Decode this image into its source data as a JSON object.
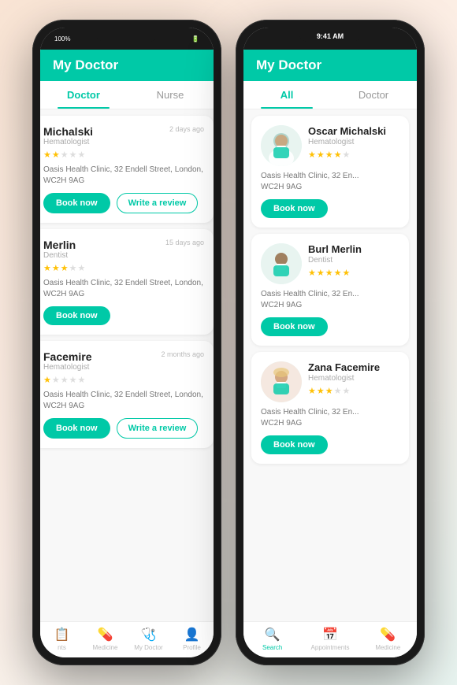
{
  "colors": {
    "primary": "#00C9A7",
    "white": "#ffffff",
    "text_dark": "#222222",
    "text_gray": "#aaaaaa",
    "text_light": "#777777",
    "star_filled": "#FFC107",
    "star_empty": "#dddddd"
  },
  "left_phone": {
    "status_bar": {
      "battery": "100%",
      "time": ""
    },
    "header": {
      "title": "My Doctor"
    },
    "tabs": [
      {
        "label": "Doctor",
        "active": true
      },
      {
        "label": "Nurse",
        "active": false
      }
    ],
    "doctors": [
      {
        "name": "Michalski",
        "full_name": "Oscar Michalski",
        "specialty": "Hematologist",
        "timestamp": "2 days ago",
        "stars": [
          true,
          true,
          false,
          false,
          false
        ],
        "address": "Oasis Health Clinic, 32 Endell Street, London, WC2H 9AG",
        "show_book": true,
        "show_review": true
      },
      {
        "name": "Merlin",
        "full_name": "Burl Merlin",
        "specialty": "Dentist",
        "timestamp": "15 days ago",
        "stars": [
          true,
          true,
          true,
          false,
          false
        ],
        "address": "Oasis Health Clinic, 32 Endell Street, London, WC2H 9AG",
        "show_book": true,
        "show_review": false
      },
      {
        "name": "Facemire",
        "full_name": "Zana Facemire",
        "specialty": "Hematologist",
        "timestamp": "2 months ago",
        "stars": [
          true,
          false,
          false,
          false,
          false
        ],
        "address": "Oasis Health Clinic, 32 Endell Street, London, WC2H 9AG",
        "show_book": true,
        "show_review": true
      }
    ],
    "bottom_nav": [
      {
        "icon": "🏠",
        "label": "nts",
        "active": false
      },
      {
        "icon": "💊",
        "label": "Medicine",
        "active": false
      },
      {
        "icon": "👤",
        "label": "My Doctor",
        "active": false
      },
      {
        "icon": "👤",
        "label": "Profile",
        "active": false
      }
    ]
  },
  "right_phone": {
    "status_bar": {
      "time": "9:41 AM"
    },
    "header": {
      "title": "My Doctor"
    },
    "tabs": [
      {
        "label": "All",
        "active": true
      },
      {
        "label": "Doctor",
        "active": false
      }
    ],
    "doctors": [
      {
        "name": "Oscar Michalski",
        "specialty": "Hematologist",
        "stars": [
          true,
          true,
          true,
          true,
          false
        ],
        "address": "Oasis Health Clinic, 32 En...\nWC2H 9AG",
        "show_book": true
      },
      {
        "name": "Burl Merlin",
        "specialty": "Dentist",
        "stars": [
          true,
          true,
          true,
          true,
          true
        ],
        "address": "Oasis Health Clinic, 32 En...\nWC2H 9AG",
        "show_book": true
      },
      {
        "name": "Zana Facemire",
        "specialty": "Hematologist",
        "stars": [
          true,
          true,
          true,
          false,
          false
        ],
        "address": "Oasis Health Clinic, 32 En...\nWC2H 9AG",
        "show_book": true
      }
    ],
    "bottom_nav": [
      {
        "icon": "🔍",
        "label": "Search",
        "active": true
      },
      {
        "icon": "📅",
        "label": "Appointments",
        "active": false
      },
      {
        "icon": "💊",
        "label": "Medicine",
        "active": false
      }
    ]
  },
  "labels": {
    "book_now": "Book now",
    "write_review": "Write a review"
  }
}
